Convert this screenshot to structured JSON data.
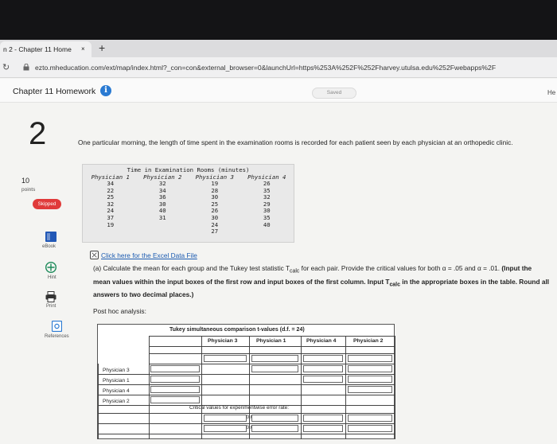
{
  "browser": {
    "tab_title": "n 2 - Chapter 11 Home",
    "tab_close": "×",
    "new_tab": "+",
    "reload_icon": "↻",
    "url": "ezto.mheducation.com/ext/map/index.html?_con=con&external_browser=0&launchUrl=https%253A%252F%252Fharvey.utulsa.edu%252Fwebapps%2F"
  },
  "header": {
    "title": "Chapter 11 Homework",
    "info": "i",
    "saved_label": "Saved",
    "right_text": "He"
  },
  "question": {
    "number": "2",
    "points_value": "10",
    "points_label": "points",
    "status": "Skipped",
    "intro": "One particular morning, the length of time spent in the examination rooms is recorded for each patient seen by each physician at an orthopedic clinic."
  },
  "sidebar": {
    "ebook": "eBook",
    "hint": "Hint",
    "print": "Print",
    "references": "References"
  },
  "data_table": {
    "title": "Time in Examination Rooms (minutes)",
    "headers": [
      "Physician 1",
      "Physician 2",
      "Physician 3",
      "Physician 4"
    ],
    "columns": [
      [
        "34",
        "22",
        "25",
        "32",
        "24",
        "37",
        "19"
      ],
      [
        "32",
        "34",
        "36",
        "30",
        "40",
        "31"
      ],
      [
        "19",
        "28",
        "30",
        "25",
        "26",
        "30",
        "24",
        "27"
      ],
      [
        "26",
        "35",
        "32",
        "29",
        "30",
        "35",
        "40"
      ]
    ]
  },
  "excel_link": "Click here for the Excel Data File",
  "part_a": {
    "lead": "(a) Calculate the mean for each group and the Tukey test statistic T",
    "sub1": "calc",
    "mid": " for each pair. Provide the critical values for both α = .05 and α = .01. ",
    "bold1": "(Input the mean values within the input boxes of the first row and input boxes of the first column. Input T",
    "sub2": "calc",
    "bold2": " in the appropriate boxes in the table. Round all answers to two decimal places.)"
  },
  "posthoc_label": "Post hoc analysis:",
  "tukey_table": {
    "title": "Tukey simultaneous comparison t-values (d.f. = 24)",
    "col_headers": [
      "Physician 3",
      "Physician 1",
      "Physician 4",
      "Physician 2"
    ],
    "row_headers": [
      "Physician 3",
      "Physician 1",
      "Physician 4",
      "Physician 2"
    ],
    "critical_label": "Critical values for experimentwise error rate:",
    "critical_rows": [
      "0.05",
      "0.01"
    ]
  }
}
